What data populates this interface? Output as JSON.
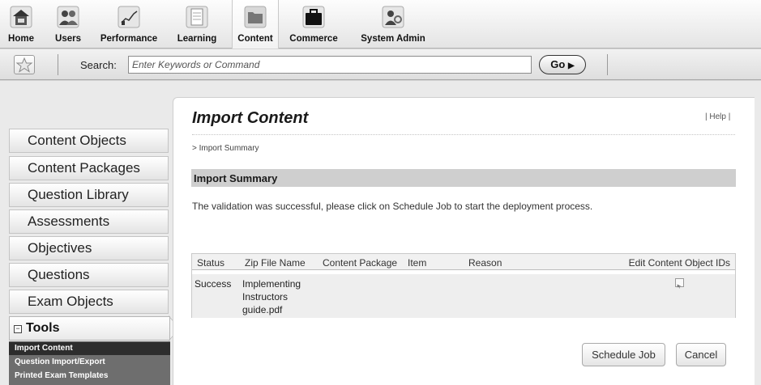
{
  "topnav": {
    "items": [
      {
        "label": "Home",
        "icon": "home-icon"
      },
      {
        "label": "Users",
        "icon": "users-icon"
      },
      {
        "label": "Performance",
        "icon": "performance-chart-icon"
      },
      {
        "label": "Learning",
        "icon": "learning-document-icon"
      },
      {
        "label": "Content",
        "icon": "content-folder-icon",
        "active": true
      },
      {
        "label": "Commerce",
        "icon": "commerce-briefcase-icon"
      },
      {
        "label": "System Admin",
        "icon": "system-admin-icon"
      }
    ]
  },
  "searchbar": {
    "label": "Search:",
    "placeholder": "Enter Keywords or Command",
    "go_label": "Go"
  },
  "sidebar": {
    "items": [
      {
        "label": "Content Objects"
      },
      {
        "label": "Content Packages"
      },
      {
        "label": "Question Library"
      },
      {
        "label": "Assessments"
      },
      {
        "label": "Objectives"
      },
      {
        "label": "Questions"
      },
      {
        "label": "Exam Objects"
      }
    ],
    "tools": {
      "label": "Tools",
      "items": [
        {
          "label": "Import Content",
          "active": true
        },
        {
          "label": "Question Import/Export"
        },
        {
          "label": "Printed Exam Templates"
        }
      ]
    }
  },
  "main": {
    "title": "Import Content",
    "help": "| Help |",
    "breadcrumb": "> Import Summary",
    "section_title": "Import Summary",
    "message": "The validation was successful, please click on Schedule Job to start the deployment process.",
    "table": {
      "headers": [
        "Status",
        "Zip File Name",
        "Content Package",
        "Item",
        "Reason",
        "Edit Content Object IDs"
      ],
      "rows": [
        {
          "status": "Success",
          "zip_lines": [
            "Implementing",
            "Instructors",
            "guide.pdf"
          ],
          "content_package": "",
          "item": "",
          "reason": ""
        }
      ]
    },
    "buttons": {
      "schedule": "Schedule Job",
      "cancel": "Cancel"
    }
  },
  "colors": {
    "page_bg": "#eaeaea",
    "panel_bg": "#ffffff",
    "section_bar": "#cfcfcf",
    "tools_submenu": "#6e6e6e",
    "tools_active": "#2d2d2d"
  }
}
